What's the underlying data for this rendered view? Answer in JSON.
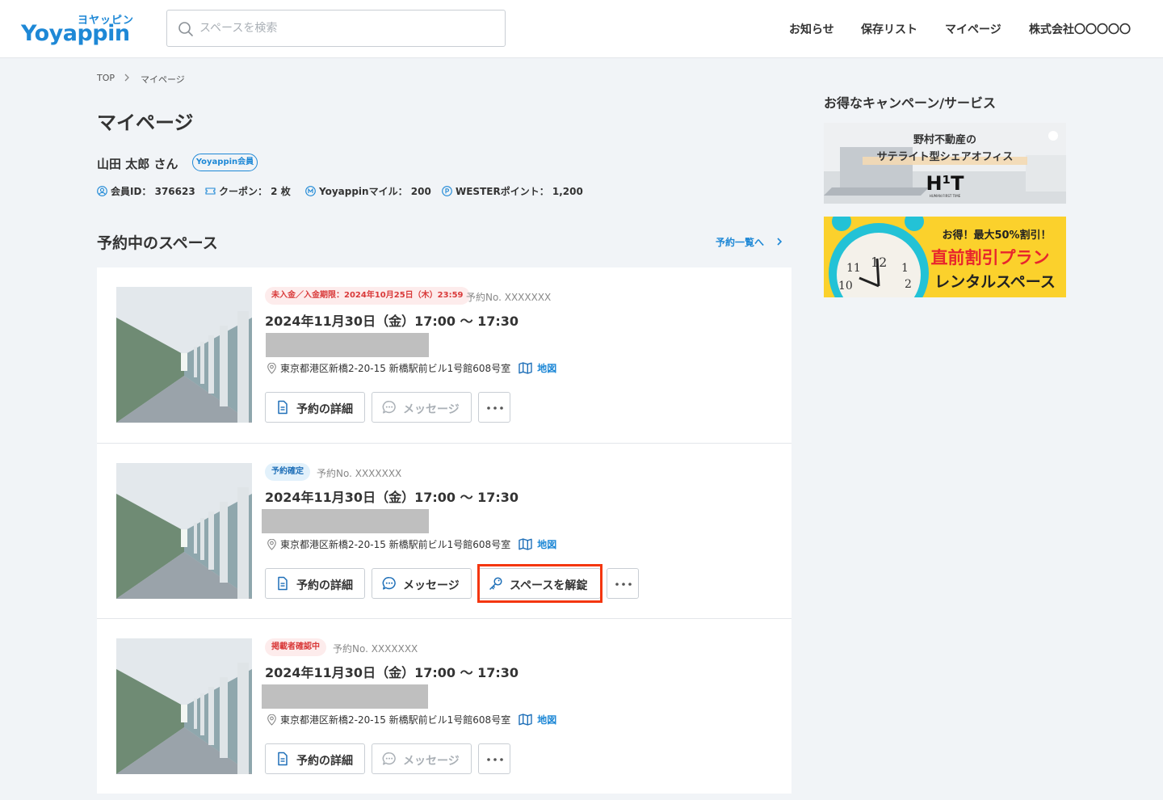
{
  "header": {
    "logo_kana": "ヨヤッピン",
    "logo_word": "Yoyappin",
    "search_placeholder": "スペースを検索",
    "nav": [
      "お知らせ",
      "保存リスト",
      "マイページ",
      "株式会社〇〇〇〇〇"
    ]
  },
  "breadcrumb": [
    "TOP",
    "マイページ"
  ],
  "page_title": "マイページ",
  "user": {
    "name": "山田 太郎 さん",
    "badge": "Yoyappin会員",
    "stats": [
      {
        "icon": "user-circle-icon",
        "text": "会員ID： 376623"
      },
      {
        "icon": "ticket-icon",
        "text": "クーポン： 2 枚"
      },
      {
        "icon": "mile-m-icon",
        "text": "Yoyappinマイル： 200"
      },
      {
        "icon": "point-p-icon",
        "text": "WESTERポイント： 1,200"
      }
    ]
  },
  "section": {
    "title": "予約中のスペース",
    "list_link": "予約一覧へ"
  },
  "reservations": [
    {
      "status": "未入金／入金期限：2024年10月25日（木）23:59",
      "status_color": "#d93a3a",
      "number": "予約No. XXXXXXX",
      "datetime": "2024年11月30日（金）17:00 〜 17:30",
      "address": "東京都港区新橋2-20-15 新橋駅前ビル1号館608号室",
      "map_label": "地図",
      "detail_label": "予約の詳細",
      "message_label": "メッセージ",
      "message_enabled": false
    },
    {
      "status": "予約確定",
      "status_color": "#1e6fb8",
      "number": "予約No. XXXXXXX",
      "datetime": "2024年11月30日（金）17:00 〜 17:30",
      "address": "東京都港区新橋2-20-15 新橋駅前ビル1号館608号室",
      "map_label": "地図",
      "detail_label": "予約の詳細",
      "message_label": "メッセージ",
      "message_enabled": true,
      "unlock_label": "スペースを解錠"
    },
    {
      "status": "掲載者確認中",
      "status_color": "#d93a3a",
      "number": "予約No. XXXXXXX",
      "datetime": "2024年11月30日（金）17:00 〜 17:30",
      "address": "東京都港区新橋2-20-15 新橋駅前ビル1号館608号室",
      "map_label": "地図",
      "detail_label": "予約の詳細",
      "message_label": "メッセージ",
      "message_enabled": false
    }
  ],
  "sidebar": {
    "title": "お得なキャンペーン/サービス",
    "banner1": {
      "line1": "野村不動産の",
      "line2": "サテライト型シェアオフィス",
      "brand": "H¹T",
      "brand_sub": "HUMAN FIRST TIME"
    },
    "banner2": {
      "line1": "お得！最大50%割引！",
      "line2": "直前割引プラン",
      "line3": "レンタルスペース"
    }
  },
  "colors": {
    "accent": "#1e88d6",
    "highlight": "#f4360f",
    "warning": "#d93a3a"
  }
}
